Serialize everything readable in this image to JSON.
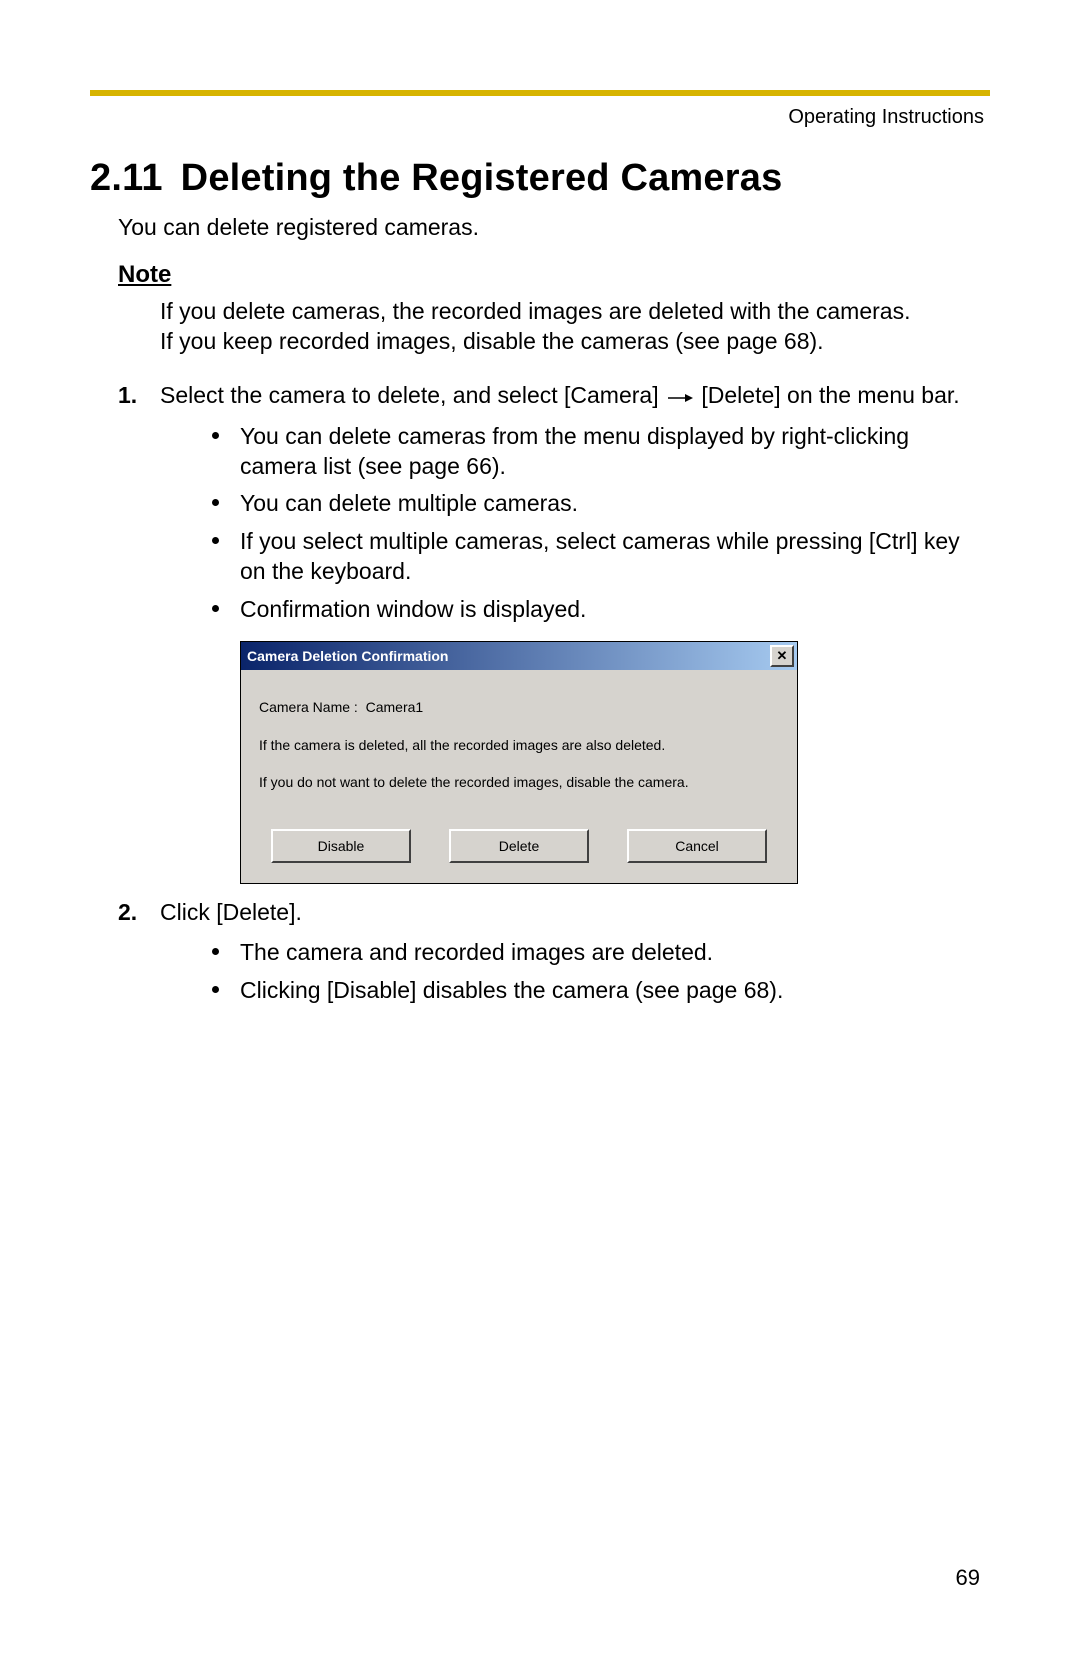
{
  "header": {
    "running_title": "Operating Instructions"
  },
  "section": {
    "number": "2.11",
    "title": "Deleting the Registered Cameras",
    "intro": "You can delete registered cameras."
  },
  "note": {
    "heading": "Note",
    "line1": "If you delete cameras, the recorded images are deleted with the cameras.",
    "line2": "If you keep recorded images, disable the cameras (see page 68)."
  },
  "steps": {
    "step1": {
      "prefix": "Select the camera to delete, and select [Camera]",
      "suffix": "[Delete] on the menu bar.",
      "bullets": [
        "You can delete cameras from the menu displayed by right-clicking camera list (see page 66).",
        "You can delete multiple cameras.",
        "If you select multiple cameras, select cameras while pressing [Ctrl] key on the keyboard.",
        "Confirmation window is displayed."
      ]
    },
    "step2": {
      "text": "Click [Delete].",
      "bullets": [
        "The camera and recorded images are deleted.",
        "Clicking [Disable] disables the camera (see page 68)."
      ]
    }
  },
  "dialog": {
    "title": "Camera Deletion Confirmation",
    "close_glyph": "✕",
    "camera_name_label": "Camera Name :",
    "camera_name_value": "Camera1",
    "warning1": "If the camera is deleted, all the recorded images are also deleted.",
    "warning2": "If you do not want to delete the recorded images, disable the camera.",
    "buttons": {
      "disable": "Disable",
      "delete": "Delete",
      "cancel": "Cancel"
    }
  },
  "page_number": "69"
}
